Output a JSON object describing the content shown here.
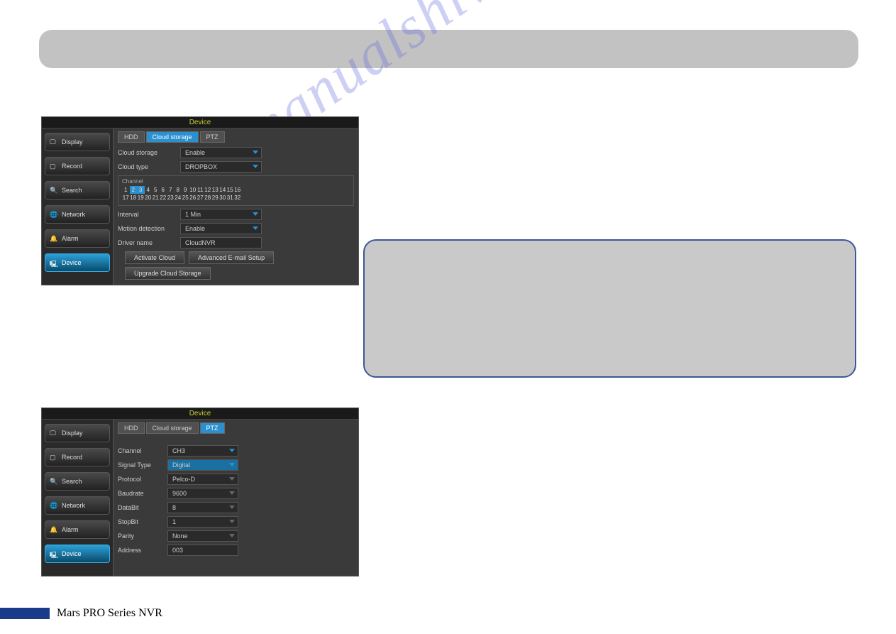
{
  "watermark": "manualshive.com",
  "footer": "Mars PRO Series NVR",
  "panel1": {
    "title": "Device",
    "sidebar": [
      {
        "label": "Display",
        "icon": "monitor"
      },
      {
        "label": "Record",
        "icon": "camera"
      },
      {
        "label": "Search",
        "icon": "search"
      },
      {
        "label": "Network",
        "icon": "globe"
      },
      {
        "label": "Alarm",
        "icon": "bell"
      },
      {
        "label": "Device",
        "icon": "device",
        "active": true
      }
    ],
    "tabs": [
      {
        "label": "HDD"
      },
      {
        "label": "Cloud storage",
        "active": true
      },
      {
        "label": "PTZ"
      }
    ],
    "fields": {
      "cloud_storage": {
        "label": "Cloud storage",
        "value": "Enable"
      },
      "cloud_type": {
        "label": "Cloud type",
        "value": "DROPBOX"
      },
      "channel_label": "Channel",
      "channels_row1": [
        "1",
        "2",
        "3",
        "4",
        "5",
        "6",
        "7",
        "8",
        "9",
        "10",
        "11",
        "12",
        "13",
        "14",
        "15",
        "16"
      ],
      "channels_row2": [
        "17",
        "18",
        "19",
        "20",
        "21",
        "22",
        "23",
        "24",
        "25",
        "26",
        "27",
        "28",
        "29",
        "30",
        "31",
        "32"
      ],
      "selected_channels": [
        "2",
        "3"
      ],
      "interval": {
        "label": "Interval",
        "value": "1 Min"
      },
      "motion": {
        "label": "Motion detection",
        "value": "Enable"
      },
      "driver": {
        "label": "Driver name",
        "value": "CloudNVR"
      }
    },
    "buttons": {
      "activate": "Activate Cloud",
      "email": "Advanced E-mail Setup",
      "upgrade": "Upgrade Cloud Storage"
    }
  },
  "panel2": {
    "title": "Device",
    "sidebar": [
      {
        "label": "Display",
        "icon": "monitor"
      },
      {
        "label": "Record",
        "icon": "camera"
      },
      {
        "label": "Search",
        "icon": "search"
      },
      {
        "label": "Network",
        "icon": "globe"
      },
      {
        "label": "Alarm",
        "icon": "bell"
      },
      {
        "label": "Device",
        "icon": "device",
        "active": true
      }
    ],
    "tabs": [
      {
        "label": "HDD"
      },
      {
        "label": "Cloud storage"
      },
      {
        "label": "PTZ",
        "active": true
      }
    ],
    "fields": {
      "channel": {
        "label": "Channel",
        "value": "CH3"
      },
      "signal": {
        "label": "Signal Type",
        "value": "Digital"
      },
      "protocol": {
        "label": "Protocol",
        "value": "Pelco-D"
      },
      "baudrate": {
        "label": "Baudrate",
        "value": "9600"
      },
      "databit": {
        "label": "DataBit",
        "value": "8"
      },
      "stopbit": {
        "label": "StopBit",
        "value": "1"
      },
      "parity": {
        "label": "Parity",
        "value": "None"
      },
      "address": {
        "label": "Address",
        "value": "003"
      }
    }
  }
}
